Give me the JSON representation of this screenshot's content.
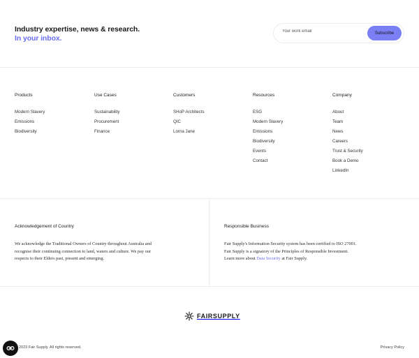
{
  "newsletter": {
    "heading_line1": "Industry expertise, news & research.",
    "heading_line2": "In your inbox.",
    "email_placeholder": "Your work email",
    "subscribe_label": "Subscribe"
  },
  "columns": [
    {
      "title": "Products",
      "links": [
        "Modern Slavery",
        "Emissions",
        "Biodiversity"
      ]
    },
    {
      "title": "Use Cases",
      "links": [
        "Sustainability",
        "Procurement",
        "Finance"
      ]
    },
    {
      "title": "Customers",
      "links": [
        "SHoP Architects",
        "QIC",
        "Lorna Jane"
      ]
    },
    {
      "title": "Resources",
      "links": [
        "ESG",
        "Modern Slavery",
        "Emissions",
        "Biodiversity",
        "Events",
        "Contact"
      ]
    },
    {
      "title": "Company",
      "links": [
        "About",
        "Team",
        "News",
        "Careers",
        "Trust & Security",
        "Book a Demo",
        "LinkedIn"
      ]
    }
  ],
  "acknowledgement": {
    "title": "Acknowledgement of Country",
    "text": "We acknowledge the Traditional Owners of Country throughout Australia and recognise their continuing connection to land, waters and culture. We pay our respects to their Elders past, present and emerging."
  },
  "responsible": {
    "title": "Responsible Business",
    "text_line1": "Fair Supply's Information Security system has been certified to ISO 27001.",
    "text_line2": "Fair Supply is a signatory of the Principles of Responsible Investment.",
    "text_line3_before": "Learn more about ",
    "text_line3_link": "Data Security",
    "text_line3_after": " at Fair Supply."
  },
  "footer": {
    "logo_text": "FAIRSUPPLY",
    "copyright": "2023 Fair Supply. All rights reserved.",
    "privacy_label": "Privacy Policy",
    "cookie_icon": "cookie-settings-icon"
  },
  "colors": {
    "accent": "#6a6ef0",
    "button": "#7b7ff4"
  }
}
